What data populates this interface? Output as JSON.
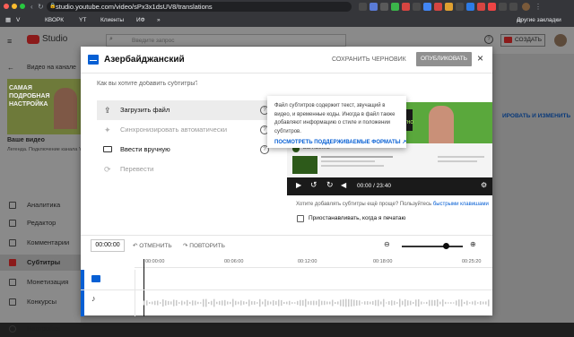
{
  "browser": {
    "url": "studio.youtube.com/video/sPx3x1dsUV8/translations",
    "bookmarks": [
      "V",
      "КВОРК",
      "YT",
      "Клиенты",
      "ИФ"
    ],
    "other_bookmarks": "Другие закладки"
  },
  "header": {
    "logo": "Studio",
    "search_placeholder": "Введите запрос",
    "create_label": "СОЗДАТЬ"
  },
  "sidebar": {
    "back_label": "Видео на канале",
    "thumb_text": "САМАЯ ПОДРОБНАЯ НАСТРОЙКА",
    "your_video": "Ваше видео",
    "video_sub": "Легенда. Подключение канала YouT...",
    "items": [
      {
        "label": "Аналитика",
        "icon": "chart-icon"
      },
      {
        "label": "Редактор",
        "icon": "film-icon"
      },
      {
        "label": "Комментарии",
        "icon": "comment-icon"
      },
      {
        "label": "Субтитры",
        "icon": "subtitles-icon",
        "active": true
      },
      {
        "label": "Монетизация",
        "icon": "dollar-icon"
      },
      {
        "label": "Конкурсы",
        "icon": "trophy-icon"
      }
    ],
    "settings": "Настройки"
  },
  "modal": {
    "lang_title": "Азербайджанский",
    "save_draft": "СОХРАНИТЬ ЧЕРНОВИК",
    "publish": "ОПУБЛИКОВАТЬ",
    "question": "Как вы хотите добавить субтитры?",
    "options": [
      {
        "label": "Загрузить файл",
        "icon": "upload-icon",
        "enabled": true,
        "highlight": true
      },
      {
        "label": "Синхронизировать автоматически",
        "icon": "sparkle-icon",
        "enabled": false
      },
      {
        "label": "Ввести вручную",
        "icon": "keyboard-icon",
        "enabled": true
      },
      {
        "label": "Перевести",
        "icon": "translate-icon",
        "enabled": false
      }
    ],
    "tooltip_text": "Файл субтитров содержит текст, звучащий в видео, и временные коды. Иногда в файл также добавляют информацию о стиле и положении субтитров.",
    "tooltip_link": "ПОСМОТРЕТЬ ПОДДЕРЖИВАЕМЫЕ ФОРМАТЫ",
    "player_time": "00:00 / 23:40",
    "hint_text": "Хотите добавлять субтитры ещё проще? Пользуйтесь ",
    "hint_link": "быстрыми клавишами",
    "pause_label": "Приостанавливать, когда я печатаю",
    "right_edit_link": "ИРОВАТЬ И ИЗМЕНИТЬ",
    "channel_title": "Всё Понятно",
    "video_banner": "ВСЕ ПОНЯТНО"
  },
  "timeline": {
    "current_time": "00:00:00",
    "undo": "ОТМЕНИТЬ",
    "redo": "ПОВТОРИТЬ",
    "ticks": [
      "00:00:00",
      "00:06:00",
      "00:12:00",
      "00:18:00",
      "00:25:20"
    ]
  },
  "colors": {
    "publish_bg": "#909090",
    "link_blue": "#065fd4",
    "active_red": "#cc0000"
  }
}
